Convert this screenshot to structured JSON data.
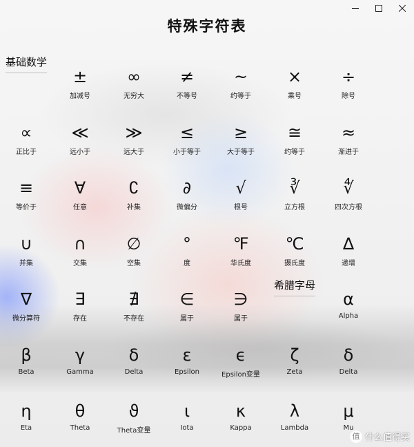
{
  "title": "特殊字符表",
  "sections": {
    "basic_math": "基础数学",
    "greek": "希腊字母"
  },
  "symbols": [
    {
      "sym": "±",
      "label": "加减号"
    },
    {
      "sym": "∞",
      "label": "无穷大"
    },
    {
      "sym": "≠",
      "label": "不等号"
    },
    {
      "sym": "~",
      "label": "约等于"
    },
    {
      "sym": "×",
      "label": "乘号"
    },
    {
      "sym": "÷",
      "label": "除号"
    },
    {
      "sym": "∝",
      "label": "正比于"
    },
    {
      "sym": "≪",
      "label": "远小于"
    },
    {
      "sym": "≫",
      "label": "远大于"
    },
    {
      "sym": "≤",
      "label": "小于等于"
    },
    {
      "sym": "≥",
      "label": "大于等于"
    },
    {
      "sym": "≅",
      "label": "约等于"
    },
    {
      "sym": "≈",
      "label": "渐进于"
    },
    {
      "sym": "≡",
      "label": "等价于"
    },
    {
      "sym": "∀",
      "label": "任意"
    },
    {
      "sym": "∁",
      "label": "补集"
    },
    {
      "sym": "∂",
      "label": "微偏分"
    },
    {
      "sym": "√",
      "label": "根号"
    },
    {
      "sym": "∛",
      "label": "立方根"
    },
    {
      "sym": "∜",
      "label": "四次方根"
    },
    {
      "sym": "∪",
      "label": "并集"
    },
    {
      "sym": "∩",
      "label": "交集"
    },
    {
      "sym": "∅",
      "label": "空集"
    },
    {
      "sym": "°",
      "label": "度"
    },
    {
      "sym": "℉",
      "label": "华氏度"
    },
    {
      "sym": "℃",
      "label": "摄氏度"
    },
    {
      "sym": "∆",
      "label": "递增"
    },
    {
      "sym": "∇",
      "label": "微分算符"
    },
    {
      "sym": "∃",
      "label": "存在"
    },
    {
      "sym": "∄",
      "label": "不存在"
    },
    {
      "sym": "∈",
      "label": "属于"
    },
    {
      "sym": "∋",
      "label": "属于"
    }
  ],
  "greek": [
    {
      "sym": "α",
      "label": "Alpha"
    },
    {
      "sym": "β",
      "label": "Beta"
    },
    {
      "sym": "γ",
      "label": "Gamma"
    },
    {
      "sym": "δ",
      "label": "Delta"
    },
    {
      "sym": "ε",
      "label": "Epsilon"
    },
    {
      "sym": "ϵ",
      "label": "Epsilon变量"
    },
    {
      "sym": "ζ",
      "label": "Zeta"
    },
    {
      "sym": "δ",
      "label": "Delta"
    },
    {
      "sym": "η",
      "label": "Eta"
    },
    {
      "sym": "θ",
      "label": "Theta"
    },
    {
      "sym": "ϑ",
      "label": "Theta变量"
    },
    {
      "sym": "ι",
      "label": "Iota"
    },
    {
      "sym": "κ",
      "label": "Kappa"
    },
    {
      "sym": "λ",
      "label": "Lambda"
    },
    {
      "sym": "μ",
      "label": "Mu"
    }
  ],
  "watermark": "什么值得买",
  "watermark_badge": "值"
}
